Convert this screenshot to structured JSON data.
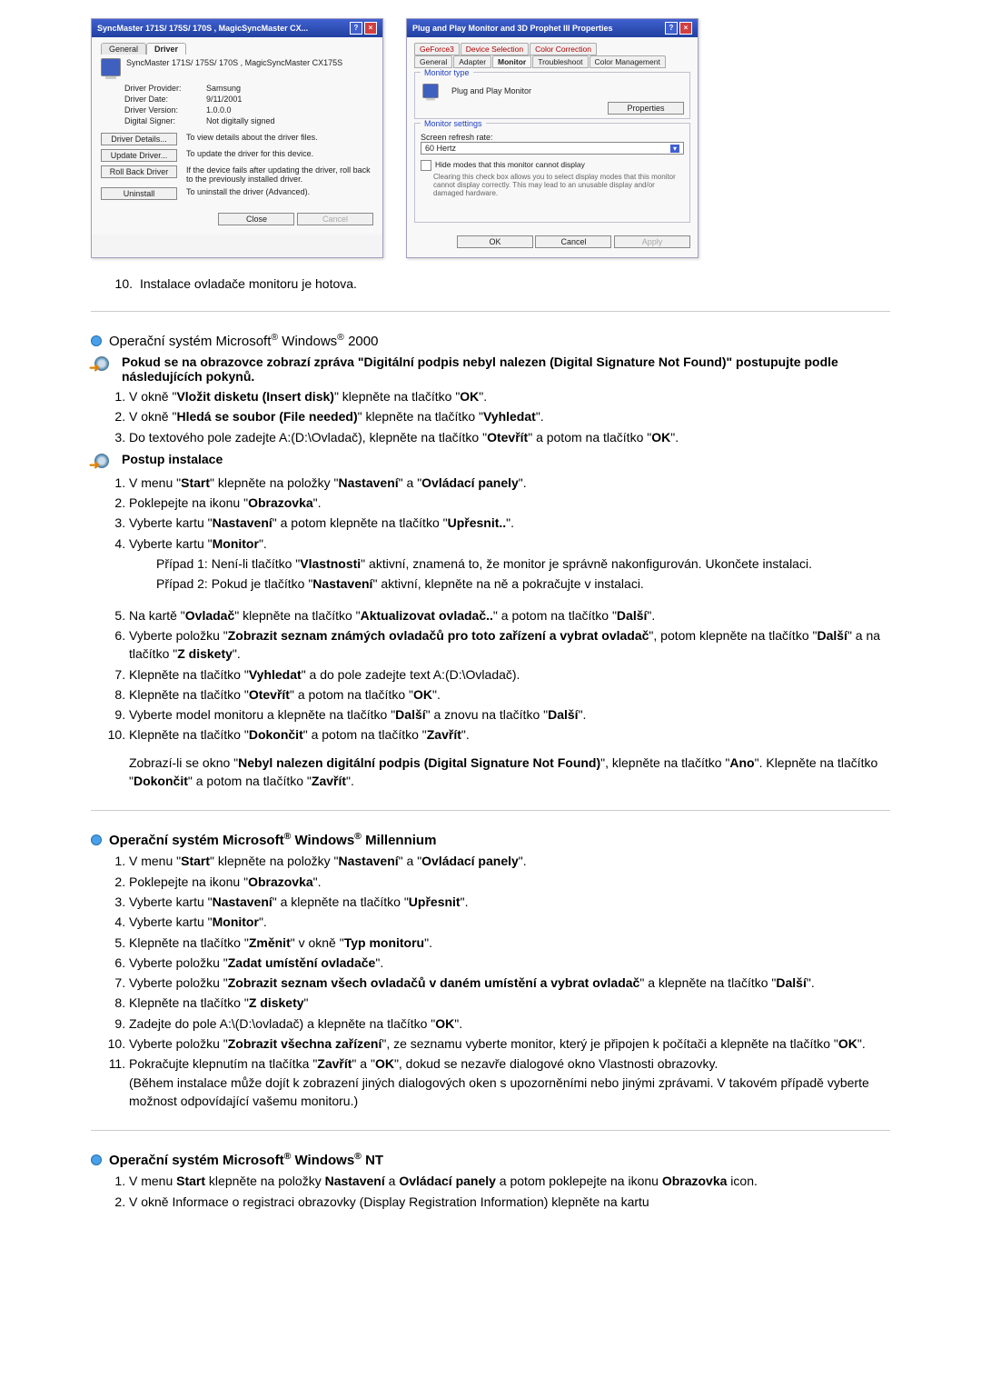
{
  "dlg1": {
    "title": "SyncMaster 171S/ 175S/ 170S , MagicSyncMaster CX...",
    "tab_general": "General",
    "tab_driver": "Driver",
    "header": "SyncMaster 171S/ 175S/ 170S , MagicSyncMaster CX175S",
    "rows": {
      "provider_k": "Driver Provider:",
      "provider_v": "Samsung",
      "date_k": "Driver Date:",
      "date_v": "9/11/2001",
      "version_k": "Driver Version:",
      "version_v": "1.0.0.0",
      "signer_k": "Digital Signer:",
      "signer_v": "Not digitally signed"
    },
    "btns": {
      "details": "Driver Details...",
      "details_txt": "To view details about the driver files.",
      "update": "Update Driver...",
      "update_txt": "To update the driver for this device.",
      "rollback": "Roll Back Driver",
      "rollback_txt": "If the device fails after updating the driver, roll back to the previously installed driver.",
      "uninstall": "Uninstall",
      "uninstall_txt": "To uninstall the driver (Advanced).",
      "close": "Close",
      "cancel": "Cancel"
    }
  },
  "dlg2": {
    "title": "Plug and Play Monitor and 3D Prophet III Properties",
    "tabs_top": [
      "GeForce3",
      "Device Selection",
      "Color Correction"
    ],
    "tabs_bot": [
      "General",
      "Adapter",
      "Monitor",
      "Troubleshoot",
      "Color Management"
    ],
    "grp_type": "Monitor type",
    "type_val": "Plug and Play Monitor",
    "properties": "Properties",
    "grp_set": "Monitor settings",
    "refresh_lbl": "Screen refresh rate:",
    "refresh_val": "60 Hertz",
    "chk1": "Hide modes that this monitor cannot display",
    "chk_note": "Clearing this check box allows you to select display modes that this monitor cannot display correctly. This may lead to an unusable display and/or damaged hardware.",
    "ok": "OK",
    "cancel": "Cancel",
    "apply": "Apply"
  },
  "line10": {
    "num": "10.",
    "text": "Instalace ovladače monitoru je hotova."
  },
  "w2000": {
    "heading": "Operační systém Microsoft® Windows® 2000",
    "warn": "Pokud se na obrazovce zobrazí zpráva \"Digitální podpis nebyl nalezen (Digital Signature Not Found)\" postupujte podle následujících pokynů.",
    "s1": "V okně \"Vložit disketu (Insert disk)\" klepněte na tlačítko \"OK\".",
    "s2": "V okně \"Hledá se soubor (File needed)\" klepněte na tlačítko \"Vyhledat\".",
    "s3": "Do textového pole zadejte A:(D:\\Ovladač), klepněte na tlačítko \"Otevřít\" a potom na tlačítko \"OK\".",
    "postup": "Postup instalace",
    "p1": "V menu \"Start\" klepněte na položky \"Nastavení\" a \"Ovládací panely\".",
    "p2": "Poklepejte na ikonu \"Obrazovka\".",
    "p3": "Vyberte kartu \"Nastavení\" a potom klepněte na tlačítko \"Upřesnit..\".",
    "p4": "Vyberte kartu \"Monitor\".",
    "p4a": "Případ 1: Není-li tlačítko \"Vlastnosti\" aktivní, znamená to, že monitor je správně nakonfigurován. Ukončete instalaci.",
    "p4b": "Případ 2: Pokud je tlačítko \"Nastavení\" aktivní, klepněte na ně a pokračujte v instalaci.",
    "p5": "Na kartě \"Ovladač\" klepněte na tlačítko \"Aktualizovat ovladač..\" a potom na tlačítko \"Další\".",
    "p6": "Vyberte položku \"Zobrazit seznam známých ovladačů pro toto zařízení a vybrat ovladač\", potom klepněte na tlačítko \"Další\" a na tlačítko \"Z diskety\".",
    "p7": "Klepněte na tlačítko \"Vyhledat\" a do pole zadejte text A:(D:\\Ovladač).",
    "p8": "Klepněte na tlačítko \"Otevřít\" a potom na tlačítko \"OK\".",
    "p9": "Vyberte model monitoru a klepněte na tlačítko \"Další\" a znovu na tlačítko \"Další\".",
    "p10": "Klepněte na tlačítko \"Dokončit\" a potom na tlačítko \"Zavřít\".",
    "note": "Zobrazí-li se okno \"Nebyl nalezen digitální podpis (Digital Signature Not Found)\", klepněte na tlačítko \"Ano\". Klepněte na tlačítko \"Dokončit\" a potom na tlačítko \"Zavřít\"."
  },
  "wme": {
    "heading": "Operační systém Microsoft® Windows® Millennium",
    "s1": "V menu \"Start\" klepněte na položky \"Nastavení\" a \"Ovládací panely\".",
    "s2": "Poklepejte na ikonu \"Obrazovka\".",
    "s3": "Vyberte kartu \"Nastavení\" a klepněte na tlačítko \"Upřesnit\".",
    "s4": "Vyberte kartu \"Monitor\".",
    "s5": "Klepněte na tlačítko \"Změnit\" v okně \"Typ monitoru\".",
    "s6": "Vyberte položku \"Zadat umístění ovladače\".",
    "s7": "Vyberte položku \"Zobrazit seznam všech ovladačů v daném umístění a vybrat ovladač\" a klepněte na tlačítko \"Další\".",
    "s8": "Klepněte na tlačítko \"Z diskety\"",
    "s9": "Zadejte do pole A:\\(D:\\ovladač) a klepněte na tlačítko \"OK\".",
    "s10": "Vyberte položku \"Zobrazit všechna zařízení\", ze seznamu vyberte monitor, který je připojen k počítači a klepněte na tlačítko \"OK\".",
    "s11a": "Pokračujte klepnutím na tlačítka \"Zavřít\" a \"OK\", dokud se nezavře dialogové okno Vlastnosti obrazovky.",
    "s11b": "(Během instalace může dojít k zobrazení jiných dialogových oken s upozorněními nebo jinými zprávami. V takovém případě vyberte možnost odpovídající vašemu monitoru.)"
  },
  "wnt": {
    "heading": "Operační systém Microsoft® Windows® NT",
    "s1": "V menu Start klepněte na položky Nastavení a Ovládací panely a potom poklepejte na ikonu Obrazovka icon.",
    "s2": "V okně Informace o registraci obrazovky (Display Registration Information) klepněte na kartu"
  }
}
